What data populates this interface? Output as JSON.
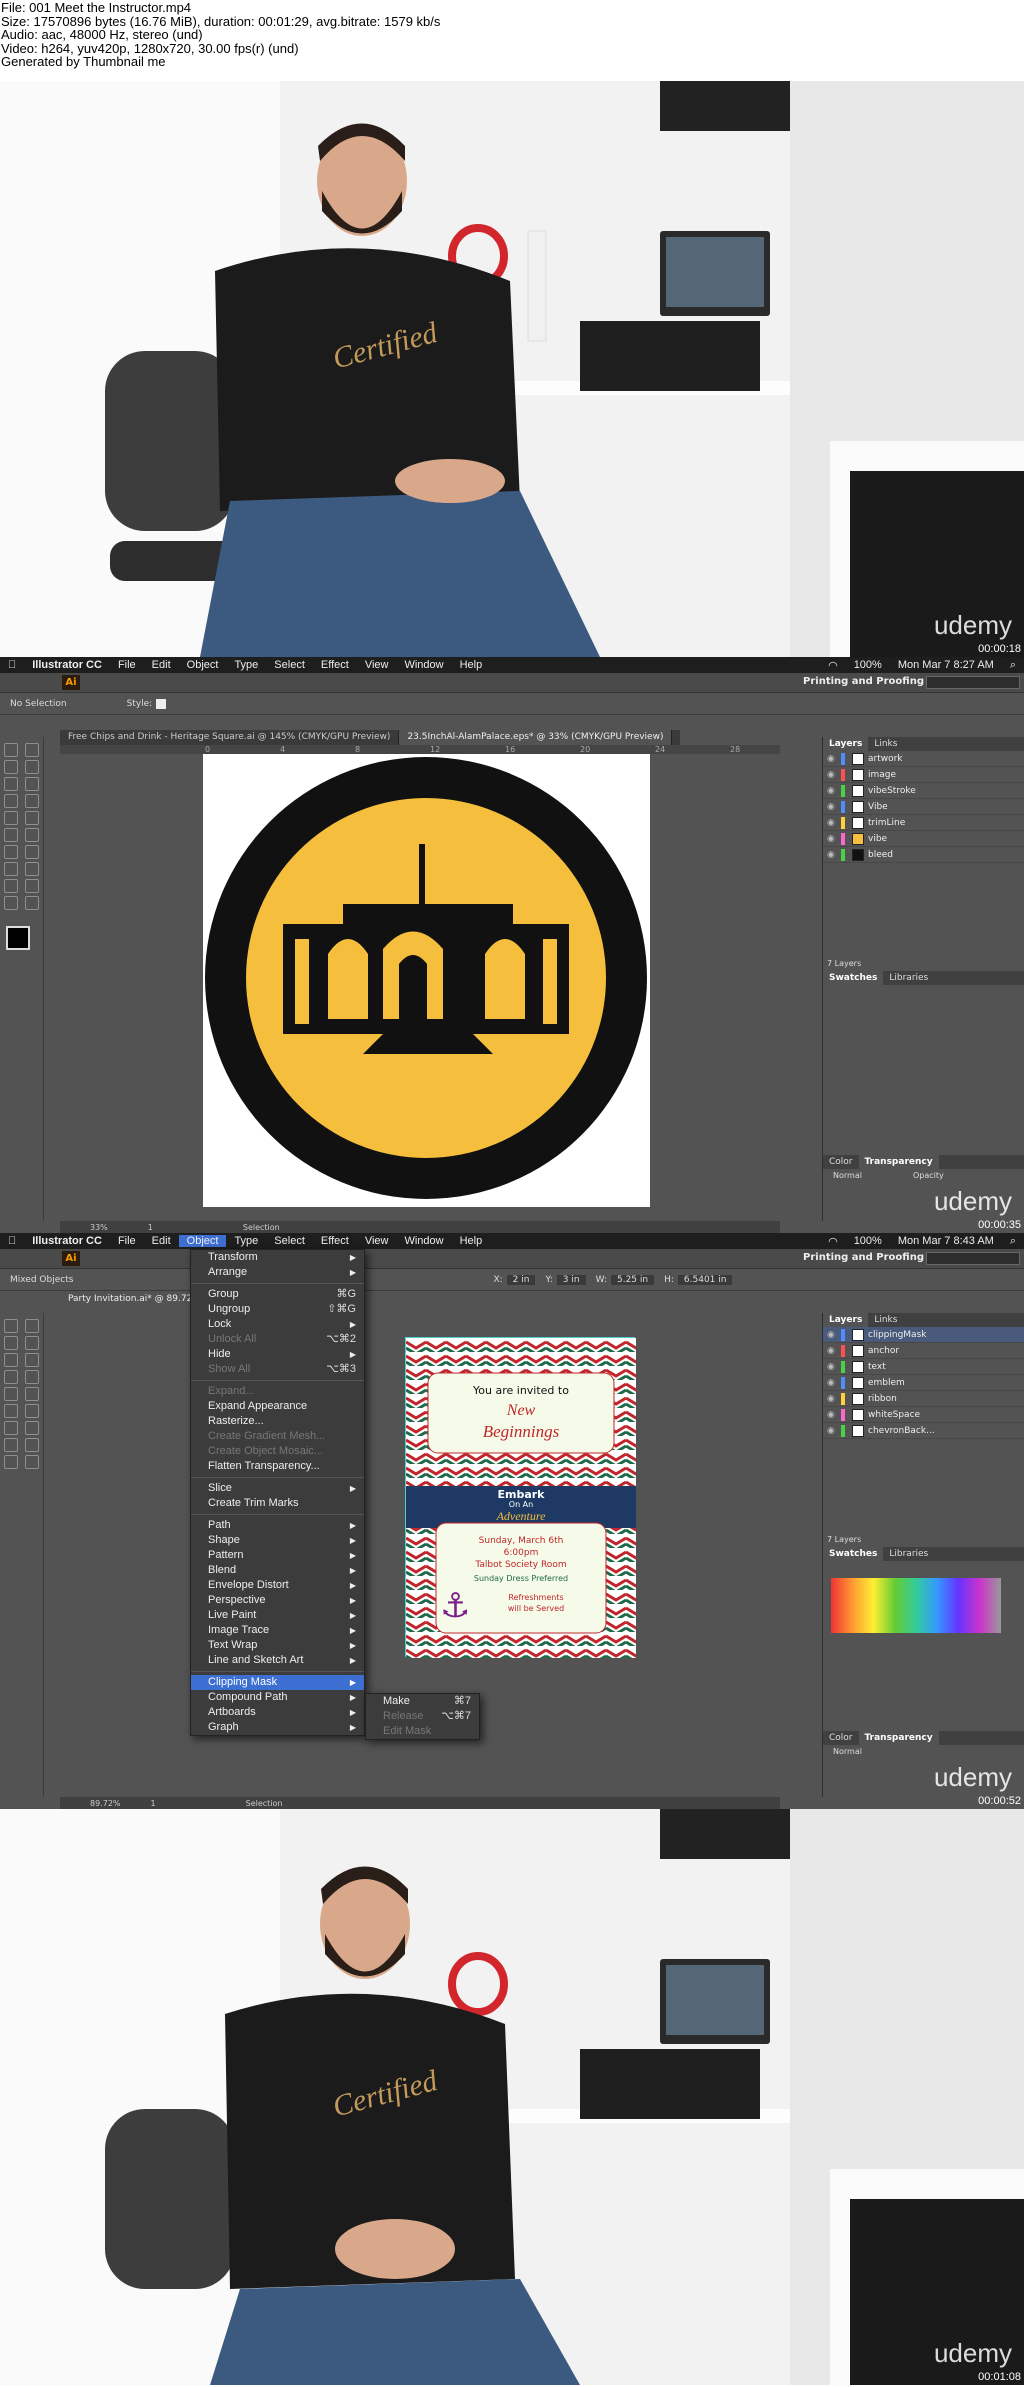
{
  "header": {
    "lines": [
      "File: 001 Meet the Instructor.mp4",
      "Size: 17570896 bytes (16.76 MiB), duration: 00:01:29, avg.bitrate: 1579 kb/s",
      "Audio: aac, 48000 Hz, stereo (und)",
      "Video: h264, yuv420p, 1280x720, 30.00 fps(r) (und)",
      "Generated by Thumbnail me"
    ]
  },
  "brand": "udemy",
  "frames": [
    {
      "timestamp": "00:00:18"
    },
    {
      "timestamp": "00:00:35"
    },
    {
      "timestamp": "00:00:52"
    },
    {
      "timestamp": "00:01:08"
    }
  ],
  "menubar": {
    "app": "Illustrator CC",
    "items": [
      "File",
      "Edit",
      "Object",
      "Type",
      "Select",
      "Effect",
      "View",
      "Window",
      "Help"
    ],
    "battery": "100%",
    "clock1": "Mon Mar 7  8:27 AM",
    "clock2": "Mon Mar 7  8:43 AM"
  },
  "ai_logo": "Ai",
  "workspace": "Printing and Proofing",
  "screen1": {
    "control_label": "No Selection",
    "style_label": "Style:",
    "tabs": [
      "Free Chips and Drink - Heritage Square.ai @ 145% (CMYK/GPU Preview)",
      "23.5InchAl-AlamPalace.eps* @ 33% (CMYK/GPU Preview)"
    ],
    "ruler_ticks": [
      "0",
      "4",
      "8",
      "12",
      "16",
      "20",
      "24",
      "28"
    ],
    "panel_tabs": [
      "Layers",
      "Links"
    ],
    "layers": [
      {
        "name": "artwork",
        "color": "#4f8cff"
      },
      {
        "name": "image",
        "color": "#ff4f4f"
      },
      {
        "name": "vibeStroke",
        "color": "#49d249"
      },
      {
        "name": "Vibe",
        "color": "#4f8cff"
      },
      {
        "name": "trimLine",
        "color": "#ffd23c"
      },
      {
        "name": "vibe",
        "color": "#ff66cc"
      },
      {
        "name": "bleed",
        "color": "#49d249"
      }
    ],
    "layer_count": "7 Layers",
    "swatch_tabs": [
      "Swatches",
      "Libraries"
    ],
    "color_tabs": [
      "Color",
      "Transparency"
    ],
    "blend": "Normal",
    "opacity_label": "Opacity",
    "zoom": "33%",
    "page": "1",
    "status": "Selection",
    "colors": {
      "seal_gold": "#f5be3c",
      "seal_ring": "#111111"
    }
  },
  "screen2": {
    "control_label": "Mixed Objects",
    "x": "2 in",
    "y": "3 in",
    "w": "5.25 in",
    "h": "6.5401 in",
    "tab": "Party Invitation.ai* @ 89.72%",
    "layers": [
      {
        "name": "clippingMask",
        "color": "#4f8cff"
      },
      {
        "name": "anchor",
        "color": "#ff4f4f"
      },
      {
        "name": "text",
        "color": "#49d249"
      },
      {
        "name": "emblem",
        "color": "#4f8cff"
      },
      {
        "name": "ribbon",
        "color": "#ffd23c"
      },
      {
        "name": "whiteSpace",
        "color": "#ff66cc"
      },
      {
        "name": "chevronBack...",
        "color": "#49d249"
      }
    ],
    "layer_count": "7 Layers",
    "zoom": "89.72%",
    "page": "1",
    "status": "Selection",
    "invitation": {
      "line1": "You are invited to",
      "line2": "New",
      "line3": "Beginnings",
      "line4": "Embark",
      "line5": "On An",
      "line6": "Adventure",
      "line7": "Sunday, March 6th",
      "line8": "6:00pm",
      "line9": "Talbot Society Room",
      "line10": "Sunday Dress Preferred",
      "line11": "Refreshments",
      "line12": "will be Served"
    }
  },
  "object_menu": {
    "items": [
      {
        "label": "Transform",
        "arrow": true
      },
      {
        "label": "Arrange",
        "arrow": true
      },
      {
        "sep": true
      },
      {
        "label": "Group",
        "shortcut": "⌘G"
      },
      {
        "label": "Ungroup",
        "shortcut": "⇧⌘G"
      },
      {
        "label": "Lock",
        "arrow": true
      },
      {
        "label": "Unlock All",
        "shortcut": "⌥⌘2",
        "disabled": true
      },
      {
        "label": "Hide",
        "arrow": true
      },
      {
        "label": "Show All",
        "shortcut": "⌥⌘3",
        "disabled": true
      },
      {
        "sep": true
      },
      {
        "label": "Expand...",
        "disabled": true
      },
      {
        "label": "Expand Appearance"
      },
      {
        "label": "Rasterize..."
      },
      {
        "label": "Create Gradient Mesh...",
        "disabled": true
      },
      {
        "label": "Create Object Mosaic...",
        "disabled": true
      },
      {
        "label": "Flatten Transparency..."
      },
      {
        "sep": true
      },
      {
        "label": "Slice",
        "arrow": true
      },
      {
        "label": "Create Trim Marks"
      },
      {
        "sep": true
      },
      {
        "label": "Path",
        "arrow": true
      },
      {
        "label": "Shape",
        "arrow": true
      },
      {
        "label": "Pattern",
        "arrow": true
      },
      {
        "label": "Blend",
        "arrow": true
      },
      {
        "label": "Envelope Distort",
        "arrow": true
      },
      {
        "label": "Perspective",
        "arrow": true
      },
      {
        "label": "Live Paint",
        "arrow": true
      },
      {
        "label": "Image Trace",
        "arrow": true
      },
      {
        "label": "Text Wrap",
        "arrow": true
      },
      {
        "label": "Line and Sketch Art",
        "arrow": true
      },
      {
        "sep": true
      },
      {
        "label": "Clipping Mask",
        "arrow": true,
        "highlight": true
      },
      {
        "label": "Compound Path",
        "arrow": true
      },
      {
        "label": "Artboards",
        "arrow": true
      },
      {
        "label": "Graph",
        "arrow": true
      }
    ],
    "submenu": [
      {
        "label": "Make",
        "shortcut": "⌘7"
      },
      {
        "label": "Release",
        "shortcut": "⌥⌘7",
        "disabled": true
      },
      {
        "label": "Edit Mask",
        "disabled": true
      }
    ]
  }
}
